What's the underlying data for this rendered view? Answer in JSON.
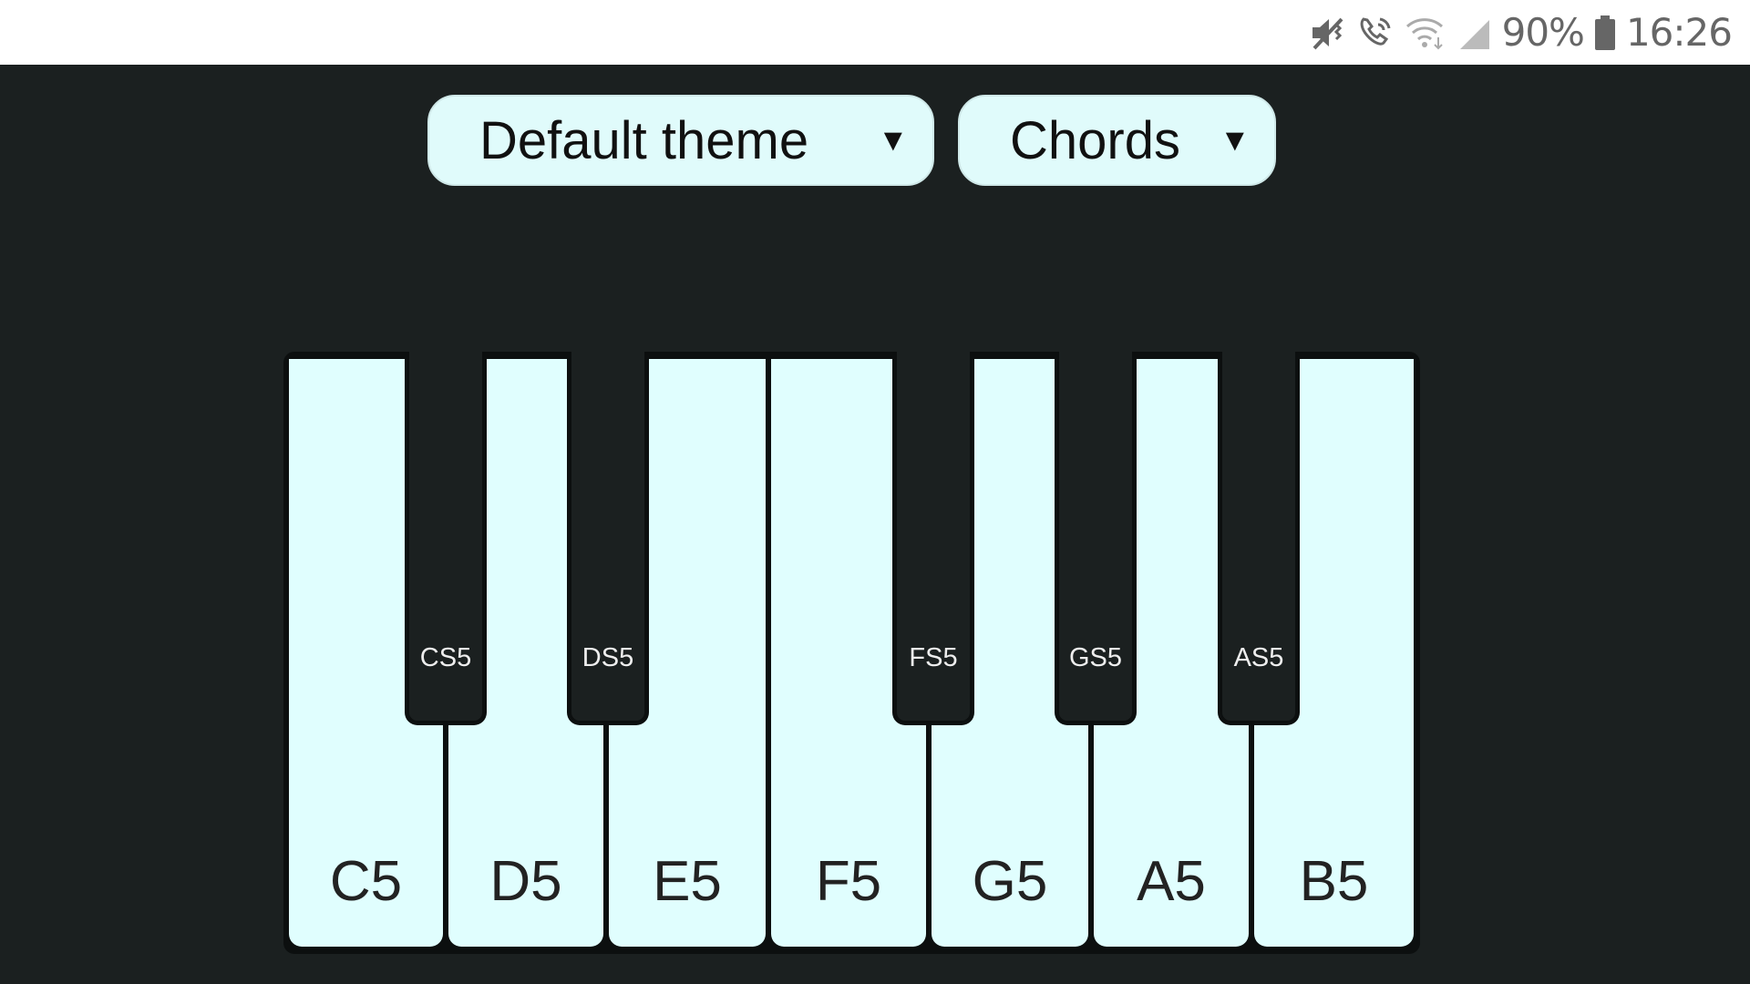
{
  "status_bar": {
    "icons": [
      "mute-vibrate-icon",
      "wifi-calling-icon",
      "wifi-icon",
      "signal-icon",
      "battery-icon"
    ],
    "battery": "90%",
    "time": "16:26"
  },
  "toolbar": {
    "theme_select": {
      "value": "Default theme",
      "arrow": "▼"
    },
    "mode_select": {
      "value": "Chords",
      "arrow": "▼"
    }
  },
  "keyboard": {
    "white_keys": [
      "C5",
      "D5",
      "E5",
      "F5",
      "G5",
      "A5",
      "B5"
    ],
    "black_keys": [
      "CS5",
      "DS5",
      "FS5",
      "GS5",
      "AS5"
    ]
  },
  "colors": {
    "background": "#1b2020",
    "white_key": "#e0fefe",
    "black_key": "#1b2020",
    "dropdown": "#e0fbfb"
  }
}
